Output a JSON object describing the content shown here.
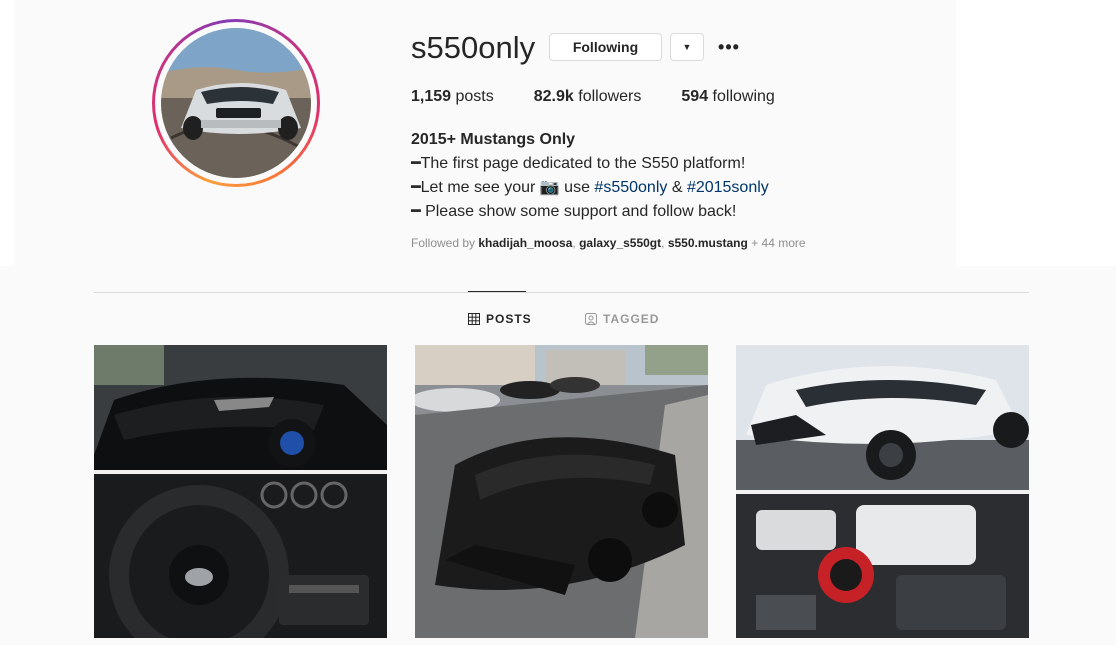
{
  "profile": {
    "username": "s550only",
    "follow_label": "Following",
    "dropdown_icon": "caret-down-icon",
    "more_icon": "more-options-icon"
  },
  "stats": {
    "posts_count": "1,159",
    "posts_label": "posts",
    "followers_count": "82.9k",
    "followers_label": "followers",
    "following_count": "594",
    "following_label": "following"
  },
  "bio": {
    "name": "2015+ Mustangs Only",
    "line1": "━The first page dedicated to the S550 platform!",
    "line2_prefix": "━Let me see your ",
    "line2_mid": " use ",
    "line2_tag1": "#s550only",
    "line2_amp": " & ",
    "line2_tag2": "#2015sonly",
    "line3": "━ Please show some support and follow back!"
  },
  "followed_by": {
    "prefix": "Followed by ",
    "user1": "khadijah_moosa",
    "sep1": ", ",
    "user2": "galaxy_s550gt",
    "sep2": ", ",
    "user3": "s550.mustang",
    "more": " + 44 more"
  },
  "tabs": [
    {
      "label": "POSTS",
      "icon": "grid-icon",
      "active": true
    },
    {
      "label": "TAGGED",
      "icon": "tagged-icon",
      "active": false
    }
  ],
  "colors": {
    "link": "#003569",
    "muted": "#8e8e8e",
    "border": "#dbdbdb"
  }
}
